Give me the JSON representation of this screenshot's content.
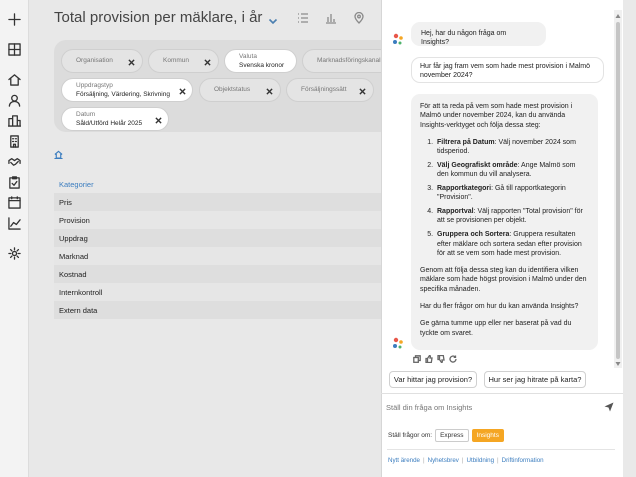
{
  "page": {
    "title": "Total provision per mäklare, i år"
  },
  "rail_icons": [
    "plus-icon",
    "grid-icon",
    "home-icon",
    "person-icon",
    "buildings-icon",
    "office-icon",
    "handshake-icon",
    "clipboard-icon",
    "calendar-icon",
    "chart-line-icon",
    "gear-icon"
  ],
  "view_icons": [
    "list-icon",
    "bar-chart-icon",
    "map-pin-icon"
  ],
  "filters": [
    {
      "label": "Organisation",
      "value": ""
    },
    {
      "label": "Kommun",
      "value": ""
    },
    {
      "label": "Valuta",
      "value": "Svenska kronor"
    },
    {
      "label": "Marknadsföringskanal",
      "value": ""
    },
    {
      "label": "Uppdragstyp",
      "value": "Försäljning, Värdering, Skrivning"
    },
    {
      "label": "Objektstatus",
      "value": ""
    },
    {
      "label": "Försäljningssätt",
      "value": ""
    },
    {
      "label": "Datum",
      "value": "Såld/Utförd Helår 2025"
    }
  ],
  "categories": {
    "heading": "Kategorier",
    "items": [
      "Pris",
      "Provision",
      "Uppdrag",
      "Marknad",
      "Kostnad",
      "Internkontroll",
      "Extern data"
    ]
  },
  "chat": {
    "greeting": "Hej, har du någon fråga om Insights?",
    "user_question": "Hur får jag fram vem som hade mest provision i Malmö november 2024?",
    "answer_intro": "För att ta reda på vem som hade mest provision i Malmö under november 2024, kan du använda Insights-verktyget och följa dessa steg:",
    "steps": [
      {
        "title": "Filtrera på Datum",
        "text": ": Välj november 2024 som tidsperiod."
      },
      {
        "title": "Välj Geografiskt område",
        "text": ": Ange Malmö som den kommun du vill analysera."
      },
      {
        "title": "Rapportkategori",
        "text": ": Gå till rapportkategorin \"Provision\"."
      },
      {
        "title": "Rapportval",
        "text": ": Välj rapporten \"Total provision\" för att se provisionen per objekt."
      },
      {
        "title": "Gruppera och Sortera",
        "text": ": Gruppera resultaten efter mäklare och sortera sedan efter provision för att se vem som hade mest provision."
      }
    ],
    "answer_summary": "Genom att följa dessa steg kan du identifiera vilken mäklare som hade högst provision i Malmö under den specifika månaden.",
    "answer_followup": "Har du fler frågor om hur du kan använda Insights?",
    "answer_feedback": "Ge gärna tumme upp eller ner baserat på vad du tyckte om svaret.",
    "suggestions": [
      "Var hittar jag provision?",
      "Hur ser jag hitrate på karta?"
    ],
    "input_placeholder": "Ställ din fråga om Insights",
    "ask_label": "Ställ frågor om:",
    "modes": [
      "Express",
      "Insights"
    ],
    "active_mode": "Insights",
    "footer_links": [
      "Nytt ärende",
      "Nyhetsbrev",
      "Utbildning",
      "Driftinformation"
    ]
  },
  "colors": {
    "accent": "#3b7dbf",
    "active_mode": "#f5a623"
  }
}
